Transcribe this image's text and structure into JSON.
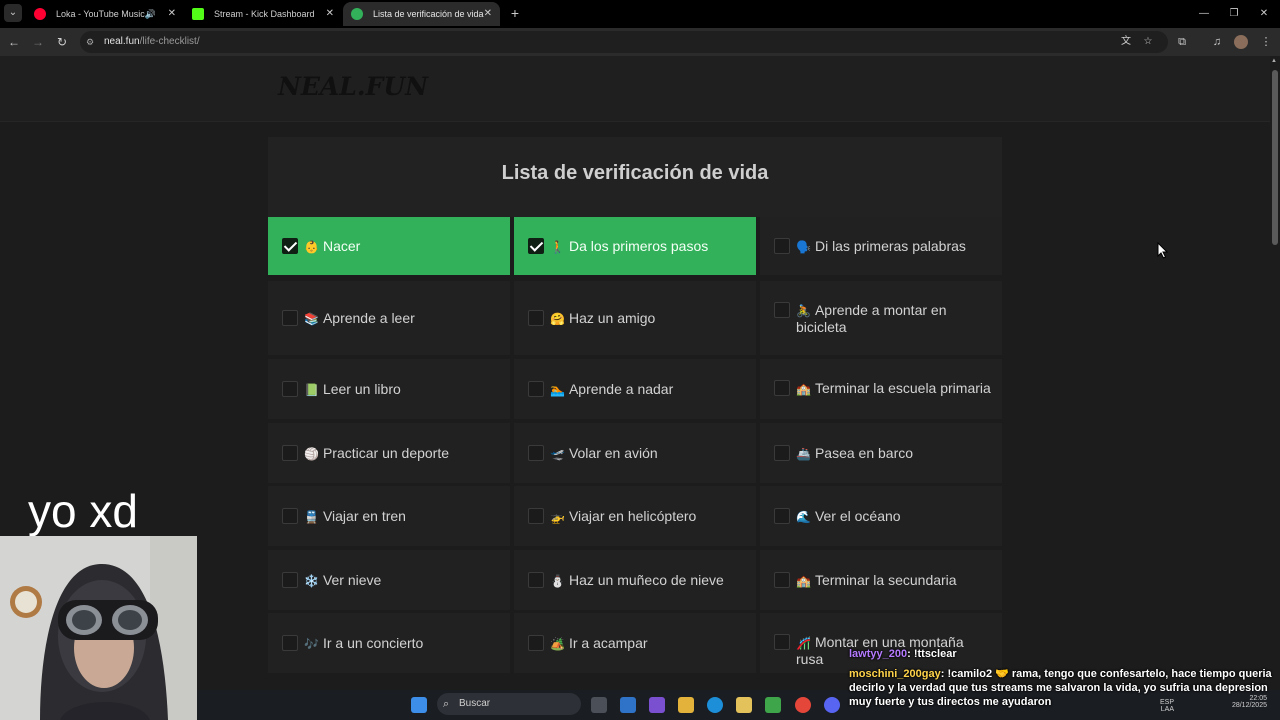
{
  "browser": {
    "tabs": [
      {
        "title": "Loka - YouTube Music",
        "favicon_color": "#ff0033"
      },
      {
        "title": "Stream - Kick Dashboard",
        "favicon_color": "#53fc18"
      },
      {
        "title": "Lista de verificación de vida",
        "favicon_color": "#33b15a"
      }
    ],
    "url_host": "neal.fun",
    "url_path": "/life-checklist/"
  },
  "site": {
    "logo": "NEAL.FUN",
    "title": "Lista de verificación de vida"
  },
  "checklist": [
    {
      "emoji": "👶",
      "label": "Nacer",
      "checked": true
    },
    {
      "emoji": "🚶",
      "label": "Da los primeros pasos",
      "checked": true
    },
    {
      "emoji": "🗣️",
      "label": "Di las primeras palabras",
      "checked": false
    },
    {
      "emoji": "📚",
      "label": "Aprende a leer",
      "checked": false
    },
    {
      "emoji": "🤗",
      "label": "Haz un amigo",
      "checked": false
    },
    {
      "emoji": "🚴",
      "label": "Aprende a montar en bicicleta",
      "checked": false
    },
    {
      "emoji": "📗",
      "label": "Leer un libro",
      "checked": false
    },
    {
      "emoji": "🏊",
      "label": "Aprende a nadar",
      "checked": false
    },
    {
      "emoji": "🏫",
      "label": "Terminar la escuela primaria",
      "checked": false
    },
    {
      "emoji": "🏐",
      "label": "Practicar un deporte",
      "checked": false
    },
    {
      "emoji": "🛫",
      "label": "Volar en avión",
      "checked": false
    },
    {
      "emoji": "🚢",
      "label": "Pasea en barco",
      "checked": false
    },
    {
      "emoji": "🚆",
      "label": "Viajar en tren",
      "checked": false
    },
    {
      "emoji": "🚁",
      "label": "Viajar en helicóptero",
      "checked": false
    },
    {
      "emoji": "🌊",
      "label": "Ver el océano",
      "checked": false
    },
    {
      "emoji": "❄️",
      "label": "Ver nieve",
      "checked": false
    },
    {
      "emoji": "⛄",
      "label": "Haz un muñeco de nieve",
      "checked": false
    },
    {
      "emoji": "🏫",
      "label": "Terminar la secundaria",
      "checked": false
    },
    {
      "emoji": "🎶",
      "label": "Ir a un concierto",
      "checked": false
    },
    {
      "emoji": "🏕️",
      "label": "Ir a acampar",
      "checked": false
    },
    {
      "emoji": "🎢",
      "label": "Montar en una montaña rusa",
      "checked": false
    }
  ],
  "overlay": {
    "caption": "yo xd"
  },
  "taskbar": {
    "search_label": "Buscar",
    "lang_top": "ESP",
    "lang_bottom": "LAA",
    "time": "22:05",
    "date": "28/12/2025"
  },
  "chat": [
    {
      "user": "lawtyy_200",
      "message": ": !ttsclear"
    },
    {
      "user": "moschini_200gay",
      "message": ": !camilo2 🤝 rama, tengo que confesartelo, hace tiempo queria decirlo y la verdad que tus streams me salvaron la vida, yo sufria una depresion muy fuerte y tus directos me ayudaron"
    }
  ]
}
